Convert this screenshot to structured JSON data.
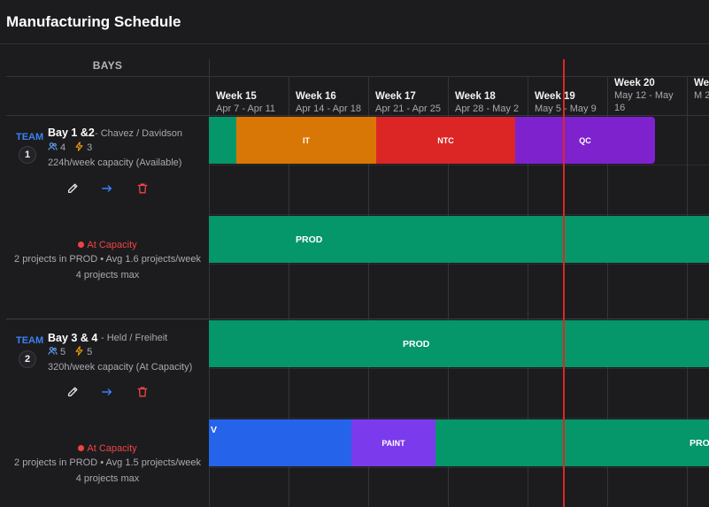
{
  "title": "Manufacturing Schedule",
  "bays_header": "BAYS",
  "weeks": [
    {
      "label": "Week 15",
      "dates": "Apr 7 - Apr 11"
    },
    {
      "label": "Week 16",
      "dates": "Apr 14 - Apr 18"
    },
    {
      "label": "Week 17",
      "dates": "Apr 21 - Apr 25"
    },
    {
      "label": "Week 18",
      "dates": "Apr 28 - May 2"
    },
    {
      "label": "Week 19",
      "dates": "May 5 - May 9"
    },
    {
      "label": "Week 20",
      "dates": "May 12 - May 16"
    },
    {
      "label": "We",
      "dates": "M 23"
    }
  ],
  "bays": [
    {
      "team_label": "TEAM",
      "team_number": "1",
      "name": "Bay 1 &2",
      "leads": "- Chavez / Davidson",
      "members": "4",
      "power": "3",
      "capacity": "224h/week capacity (Available)",
      "status": "At Capacity",
      "projects_line": "2 projects in PROD • Avg 1.6 projects/week",
      "max_line": "4 projects max",
      "row1_bars": [
        {
          "label": "",
          "color": "#059669"
        },
        {
          "label": "IT",
          "color": "#d97706"
        },
        {
          "label": "NTC",
          "color": "#dc2626"
        },
        {
          "label": "QC",
          "color": "#7e22ce"
        }
      ],
      "row2_bars": [
        {
          "label": "PROD",
          "color": "#059669"
        }
      ]
    },
    {
      "team_label": "TEAM",
      "team_number": "2",
      "name": "Bay 3 & 4",
      "leads": "- Held / Freiheit",
      "members": "5",
      "power": "5",
      "capacity": "320h/week capacity (At Capacity)",
      "status": "At Capacity",
      "projects_line": "2 projects in PROD • Avg 1.5 projects/week",
      "max_line": "4 projects max",
      "row1_bars": [
        {
          "label": "PROD",
          "color": "#059669"
        }
      ],
      "row2_bars": [
        {
          "label": "V",
          "color": "#2563eb"
        },
        {
          "label": "PAINT",
          "color": "#7c3aed"
        },
        {
          "label": "PRO",
          "color": "#059669"
        }
      ]
    }
  ],
  "icons": {
    "edit": "pencil-icon",
    "move": "arrow-right-icon",
    "delete": "trash-icon",
    "members": "users-icon",
    "power": "lightning-icon"
  },
  "colors": {
    "today_line": "#dc2626",
    "team_label": "#3b82f6",
    "status_red": "#ef4444"
  }
}
